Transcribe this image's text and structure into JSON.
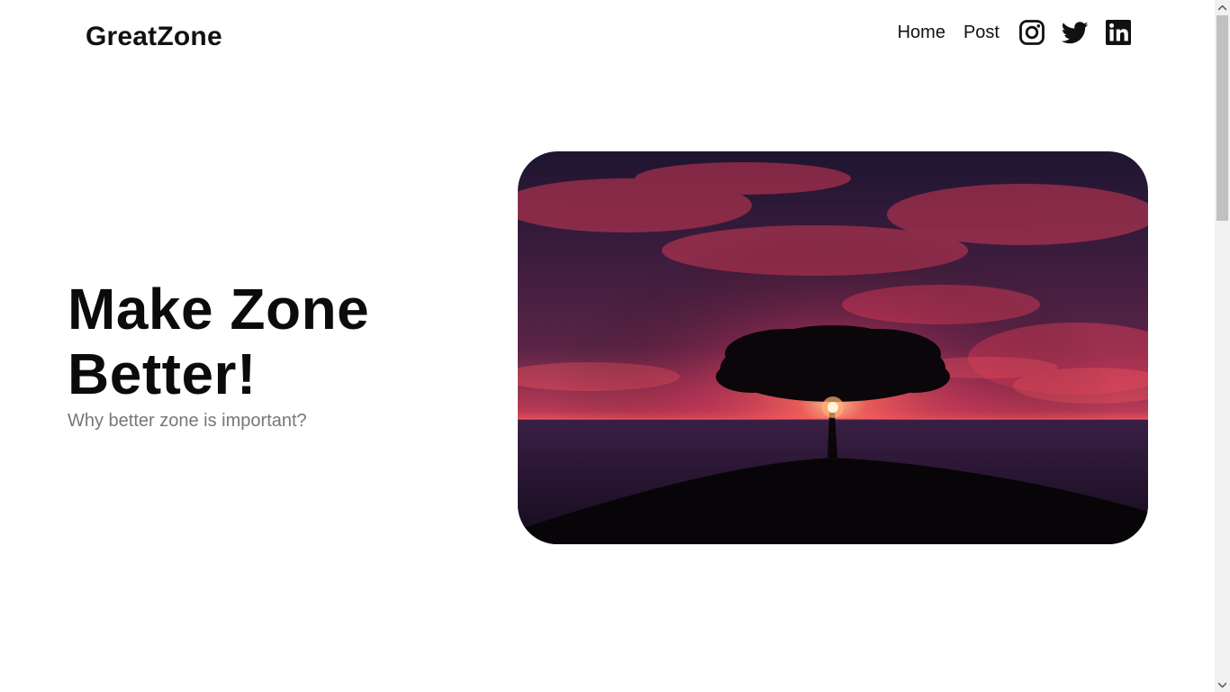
{
  "header": {
    "brand": "GreatZone",
    "nav": [
      {
        "label": "Home"
      },
      {
        "label": "Post"
      }
    ],
    "social_icons": [
      "instagram-icon",
      "twitter-icon",
      "linkedin-icon"
    ]
  },
  "hero": {
    "title_line1": "Make Zone",
    "title_line2": "Better!",
    "subtitle": "Why better zone is important?",
    "image_alt": "Silhouette of a tree on a hill at sunset over the sea under a red sky"
  },
  "colors": {
    "text": "#111111",
    "subtitle": "#777777",
    "background": "#ffffff"
  }
}
